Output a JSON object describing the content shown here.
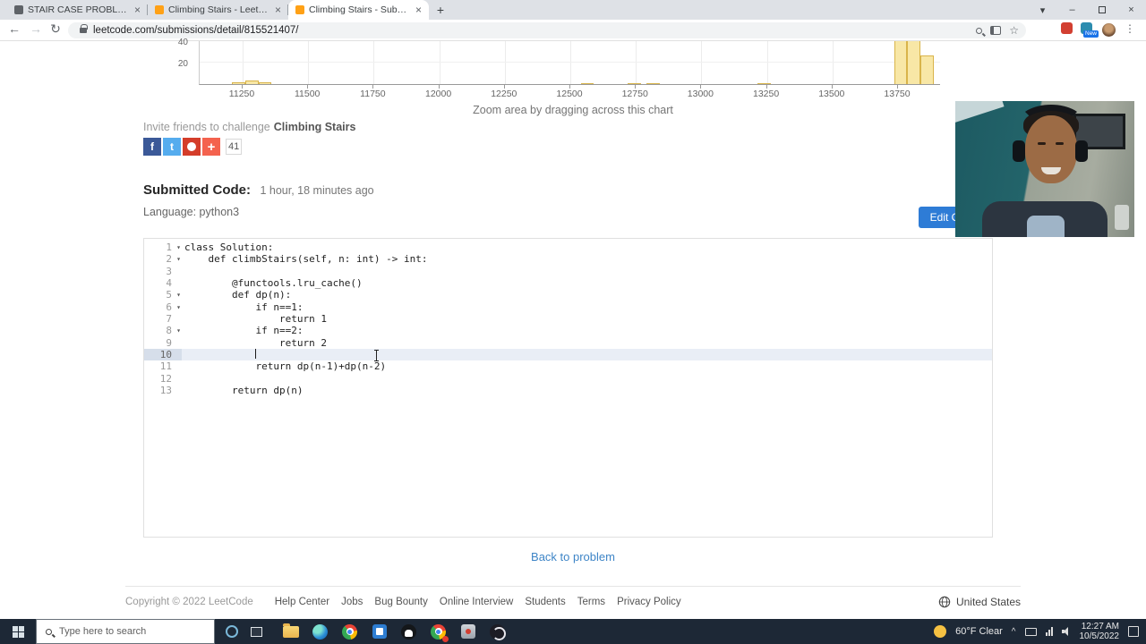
{
  "colors": {
    "primary_button": "#2e7cd6",
    "link": "#3e85c7",
    "bar_fill": "#f8e7a6",
    "bar_border": "#d9b44a",
    "active_line": "#e9eef6",
    "taskbar_bg": "#1d2836"
  },
  "icons": {
    "close": "×",
    "plus": "+",
    "back": "←",
    "forward": "→",
    "reload": "↻",
    "star": "☆",
    "kebab": "⋮",
    "tab_chevron": "▾",
    "minimize": "–",
    "fold": "▾",
    "tray_chevron": "^"
  },
  "browser": {
    "tabs": [
      {
        "title": "STAIR CASE PROBLEM LEETCOD!",
        "active": false
      },
      {
        "title": "Climbing Stairs - LeetCode",
        "active": false
      },
      {
        "title": "Climbing Stairs - Submission De",
        "active": true
      }
    ],
    "url": "leetcode.com/submissions/detail/815521407/",
    "extension_badge": "New"
  },
  "chart_data": {
    "type": "bar",
    "hint": "Zoom area by dragging across this chart",
    "x_ticks": [
      11250,
      11500,
      11750,
      12000,
      12250,
      12500,
      12750,
      13000,
      13250,
      13500,
      13750
    ],
    "y_ticks": [
      20,
      40
    ],
    "bin_width": 50,
    "bars": [
      {
        "x": 11210,
        "count": 2
      },
      {
        "x": 11260,
        "count": 3
      },
      {
        "x": 11310,
        "count": 2
      },
      {
        "x": 12540,
        "count": 1
      },
      {
        "x": 12720,
        "count": 1
      },
      {
        "x": 12790,
        "count": 1
      },
      {
        "x": 13215,
        "count": 1
      },
      {
        "x": 13735,
        "count": 50
      },
      {
        "x": 13785,
        "count": 44
      },
      {
        "x": 13835,
        "count": 27
      }
    ]
  },
  "invite": {
    "text": "Invite friends to challenge",
    "problem": "Climbing Stairs"
  },
  "share": {
    "count": "41"
  },
  "submission": {
    "title": "Submitted Code:",
    "time_ago": "1 hour, 18 minutes ago",
    "language": "Language: python3",
    "edit_button": "Edit Code"
  },
  "code": {
    "lines": [
      {
        "n": "1",
        "text": "class Solution:",
        "fold": true
      },
      {
        "n": "2",
        "text": "    def climbStairs(self, n: int) -> int:",
        "fold": true
      },
      {
        "n": "3",
        "text": ""
      },
      {
        "n": "4",
        "text": "        @functools.lru_cache()"
      },
      {
        "n": "5",
        "text": "        def dp(n):",
        "fold": true
      },
      {
        "n": "6",
        "text": "            if n==1:",
        "fold": true
      },
      {
        "n": "7",
        "text": "                return 1"
      },
      {
        "n": "8",
        "text": "            if n==2:",
        "fold": true
      },
      {
        "n": "9",
        "text": "                return 2"
      },
      {
        "n": "10",
        "text": "            ",
        "active": true
      },
      {
        "n": "11",
        "text": "            return dp(n-1)+dp(n-2)"
      },
      {
        "n": "12",
        "text": ""
      },
      {
        "n": "13",
        "text": "        return dp(n)"
      }
    ]
  },
  "back_link": {
    "label": "Back to problem"
  },
  "footer": {
    "copyright": "Copyright © 2022 LeetCode",
    "links": [
      "Help Center",
      "Jobs",
      "Bug Bounty",
      "Online Interview",
      "Students",
      "Terms",
      "Privacy Policy"
    ],
    "region": "United States"
  },
  "taskbar": {
    "search_placeholder": "Type here to search",
    "weather": "60°F Clear",
    "time": "12:27 AM",
    "date": "10/5/2022"
  }
}
